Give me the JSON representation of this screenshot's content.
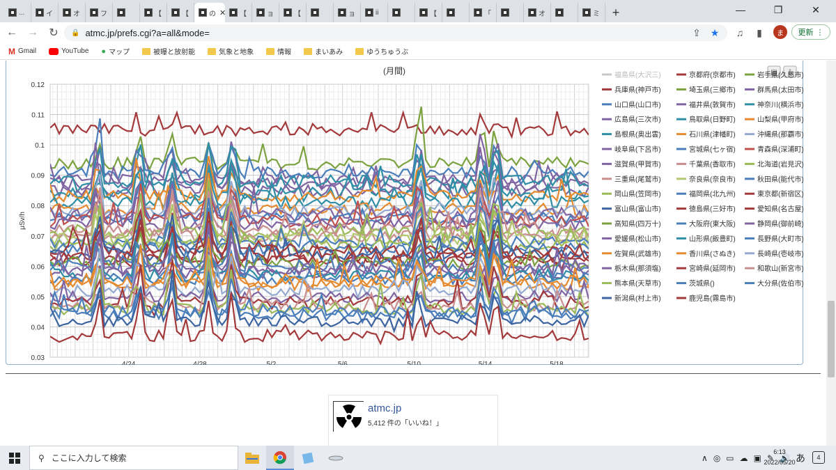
{
  "browser": {
    "tabs": [
      {
        "label": "..."
      },
      {
        "label": "イ"
      },
      {
        "label": "オ"
      },
      {
        "label": "フ"
      },
      {
        "label": ""
      },
      {
        "label": "【"
      },
      {
        "label": "【"
      },
      {
        "label": "の",
        "active": true
      },
      {
        "label": "【"
      },
      {
        "label": "ョ"
      },
      {
        "label": "【"
      },
      {
        "label": ""
      },
      {
        "label": "ョ"
      },
      {
        "label": "ii"
      },
      {
        "label": ""
      },
      {
        "label": "【"
      },
      {
        "label": ""
      },
      {
        "label": "「"
      },
      {
        "label": ""
      },
      {
        "label": "オ"
      },
      {
        "label": ""
      },
      {
        "label": "ミ"
      }
    ],
    "url": "atmc.jp/prefs.cgi?a=all&mode=",
    "avatar_letter": "ま",
    "update_label": "更新",
    "bookmarks": [
      {
        "label": "Gmail",
        "icon": "gmail-icon"
      },
      {
        "label": "YouTube",
        "icon": "youtube-icon"
      },
      {
        "label": "マップ",
        "icon": "maps-icon"
      },
      {
        "label": "被曝と放射能",
        "icon": "folder-icon"
      },
      {
        "label": "気象と地象",
        "icon": "folder-icon"
      },
      {
        "label": "情報",
        "icon": "folder-icon"
      },
      {
        "label": "まいあみ",
        "icon": "folder-icon"
      },
      {
        "label": "ゆうちゅうぶ",
        "icon": "folder-icon"
      }
    ]
  },
  "chart_data": {
    "type": "line",
    "title": "(月間)",
    "ylabel": "μSv/h",
    "ylim": [
      0.03,
      0.12
    ],
    "yticks": [
      "0.03",
      "0.04",
      "0.05",
      "0.06",
      "0.07",
      "0.08",
      "0.09",
      "0.1",
      "0.11",
      "0.12"
    ],
    "xticks": [
      {
        "label": "4/24",
        "x": 6
      },
      {
        "label": "4/28",
        "x": 10
      },
      {
        "label": "5/2",
        "x": 14
      },
      {
        "label": "5/6",
        "x": 18
      },
      {
        "label": "5/10",
        "x": 22
      },
      {
        "label": "5/14",
        "x": 26
      },
      {
        "label": "5/18",
        "x": 30
      }
    ],
    "xlim": [
      1.6,
      31.8
    ],
    "series": [
      {
        "name": "福島県(大沢三)",
        "color": "#c8c8c8",
        "base": 0.0,
        "hidden": true
      },
      {
        "name": "京都府(京都市)",
        "color": "#a3393a",
        "base": 0.0
      },
      {
        "name": "岩手県(久慈市)",
        "color": "#7ba23f",
        "base": 0.0
      },
      {
        "name": "兵庫県(神戸市)",
        "color": "#a3393a",
        "base": 0.105
      },
      {
        "name": "埼玉県(三郷市)",
        "color": "#7ba23f",
        "base": 0.094
      },
      {
        "name": "群馬県(太田市)",
        "color": "#8064a2",
        "base": 0.089
      },
      {
        "name": "山口県(山口市)",
        "color": "#4a7ebb",
        "base": 0.091
      },
      {
        "name": "福井県(敦賀市)",
        "color": "#8064a2",
        "base": 0.087
      },
      {
        "name": "神奈川(横浜市)",
        "color": "#2e8fa6",
        "base": 0.088
      },
      {
        "name": "広島県(三次市)",
        "color": "#8064a2",
        "base": 0.085
      },
      {
        "name": "鳥取県(日野町)",
        "color": "#2e8fa6",
        "base": 0.084
      },
      {
        "name": "山梨県(甲府市)",
        "color": "#e58a2f",
        "base": 0.083
      },
      {
        "name": "島根県(奥出雲)",
        "color": "#2e8fa6",
        "base": 0.081
      },
      {
        "name": "石川県(津幡町)",
        "color": "#e58a2f",
        "base": 0.079
      },
      {
        "name": "沖縄県(那覇市)",
        "color": "#93a9d0",
        "base": 0.078
      },
      {
        "name": "岐阜県(下呂市)",
        "color": "#8064a2",
        "base": 0.077
      },
      {
        "name": "宮城県(七ヶ宿)",
        "color": "#4a7ebb",
        "base": 0.076
      },
      {
        "name": "青森県(深浦町)",
        "color": "#c0504d",
        "base": 0.075
      },
      {
        "name": "滋賀県(甲賀市)",
        "color": "#8064a2",
        "base": 0.074
      },
      {
        "name": "千葉県(香取市)",
        "color": "#c98f8e",
        "base": 0.072
      },
      {
        "name": "北海道(岩見沢)",
        "color": "#9bbb59",
        "base": 0.071
      },
      {
        "name": "三重県(尾鷲市)",
        "color": "#c98f8e",
        "base": 0.07
      },
      {
        "name": "奈良県(奈良市)",
        "color": "#b3c86c",
        "base": 0.069
      },
      {
        "name": "秋田県(能代市)",
        "color": "#4a7ebb",
        "base": 0.068
      },
      {
        "name": "岡山県(笠岡市)",
        "color": "#9bbb59",
        "base": 0.067
      },
      {
        "name": "福岡県(北九州)",
        "color": "#4a7ebb",
        "base": 0.066
      },
      {
        "name": "東京都(新宿区)",
        "color": "#a3393a",
        "base": 0.065
      },
      {
        "name": "富山県(富山市)",
        "color": "#3b64a0",
        "base": 0.064
      },
      {
        "name": "徳島県(三好市)",
        "color": "#a3393a",
        "base": 0.063
      },
      {
        "name": "愛知県(名古屋)",
        "color": "#a3393a",
        "base": 0.062
      },
      {
        "name": "高知県(四万十)",
        "color": "#7ba23f",
        "base": 0.061
      },
      {
        "name": "大阪府(東大阪)",
        "color": "#4a7ebb",
        "base": 0.06
      },
      {
        "name": "静岡県(御前崎)",
        "color": "#8064a2",
        "base": 0.059
      },
      {
        "name": "愛媛県(松山市)",
        "color": "#8064a2",
        "base": 0.058
      },
      {
        "name": "山形県(飯豊町)",
        "color": "#2e8fa6",
        "base": 0.057
      },
      {
        "name": "長野県(大町市)",
        "color": "#4a7ebb",
        "base": 0.056
      },
      {
        "name": "佐賀県(武雄市)",
        "color": "#e58a2f",
        "base": 0.055
      },
      {
        "name": "香川県(さぬき)",
        "color": "#e58a2f",
        "base": 0.054
      },
      {
        "name": "長崎県(壱岐市)",
        "color": "#93a9d0",
        "base": 0.052
      },
      {
        "name": "栃木県(那須塩)",
        "color": "#8064a2",
        "base": 0.05
      },
      {
        "name": "宮崎県(延岡市)",
        "color": "#a3393a",
        "base": 0.048
      },
      {
        "name": "和歌山(新宮市)",
        "color": "#c98f8e",
        "base": 0.047
      },
      {
        "name": "熊本県(天草市)",
        "color": "#9bbb59",
        "base": 0.046
      },
      {
        "name": "茨城県()",
        "color": "#4a7ebb",
        "base": 0.045
      },
      {
        "name": "大分県(佐伯市)",
        "color": "#4a7ebb",
        "base": 0.044
      },
      {
        "name": "新潟県(村上市)",
        "color": "#3b64a0",
        "base": 0.042
      },
      {
        "name": "鹿児島(霧島市)",
        "color": "#a3393a",
        "base": 0.037
      }
    ],
    "grid": true,
    "legend": "right"
  },
  "facebook_box": {
    "name": "atmc.jp",
    "likes": "5,412 件の「いいね！」"
  },
  "taskbar": {
    "search_placeholder": "ここに入力して検索",
    "ime": "あ",
    "time": "6:13",
    "date": "2022/05/20",
    "notifications": "4"
  }
}
